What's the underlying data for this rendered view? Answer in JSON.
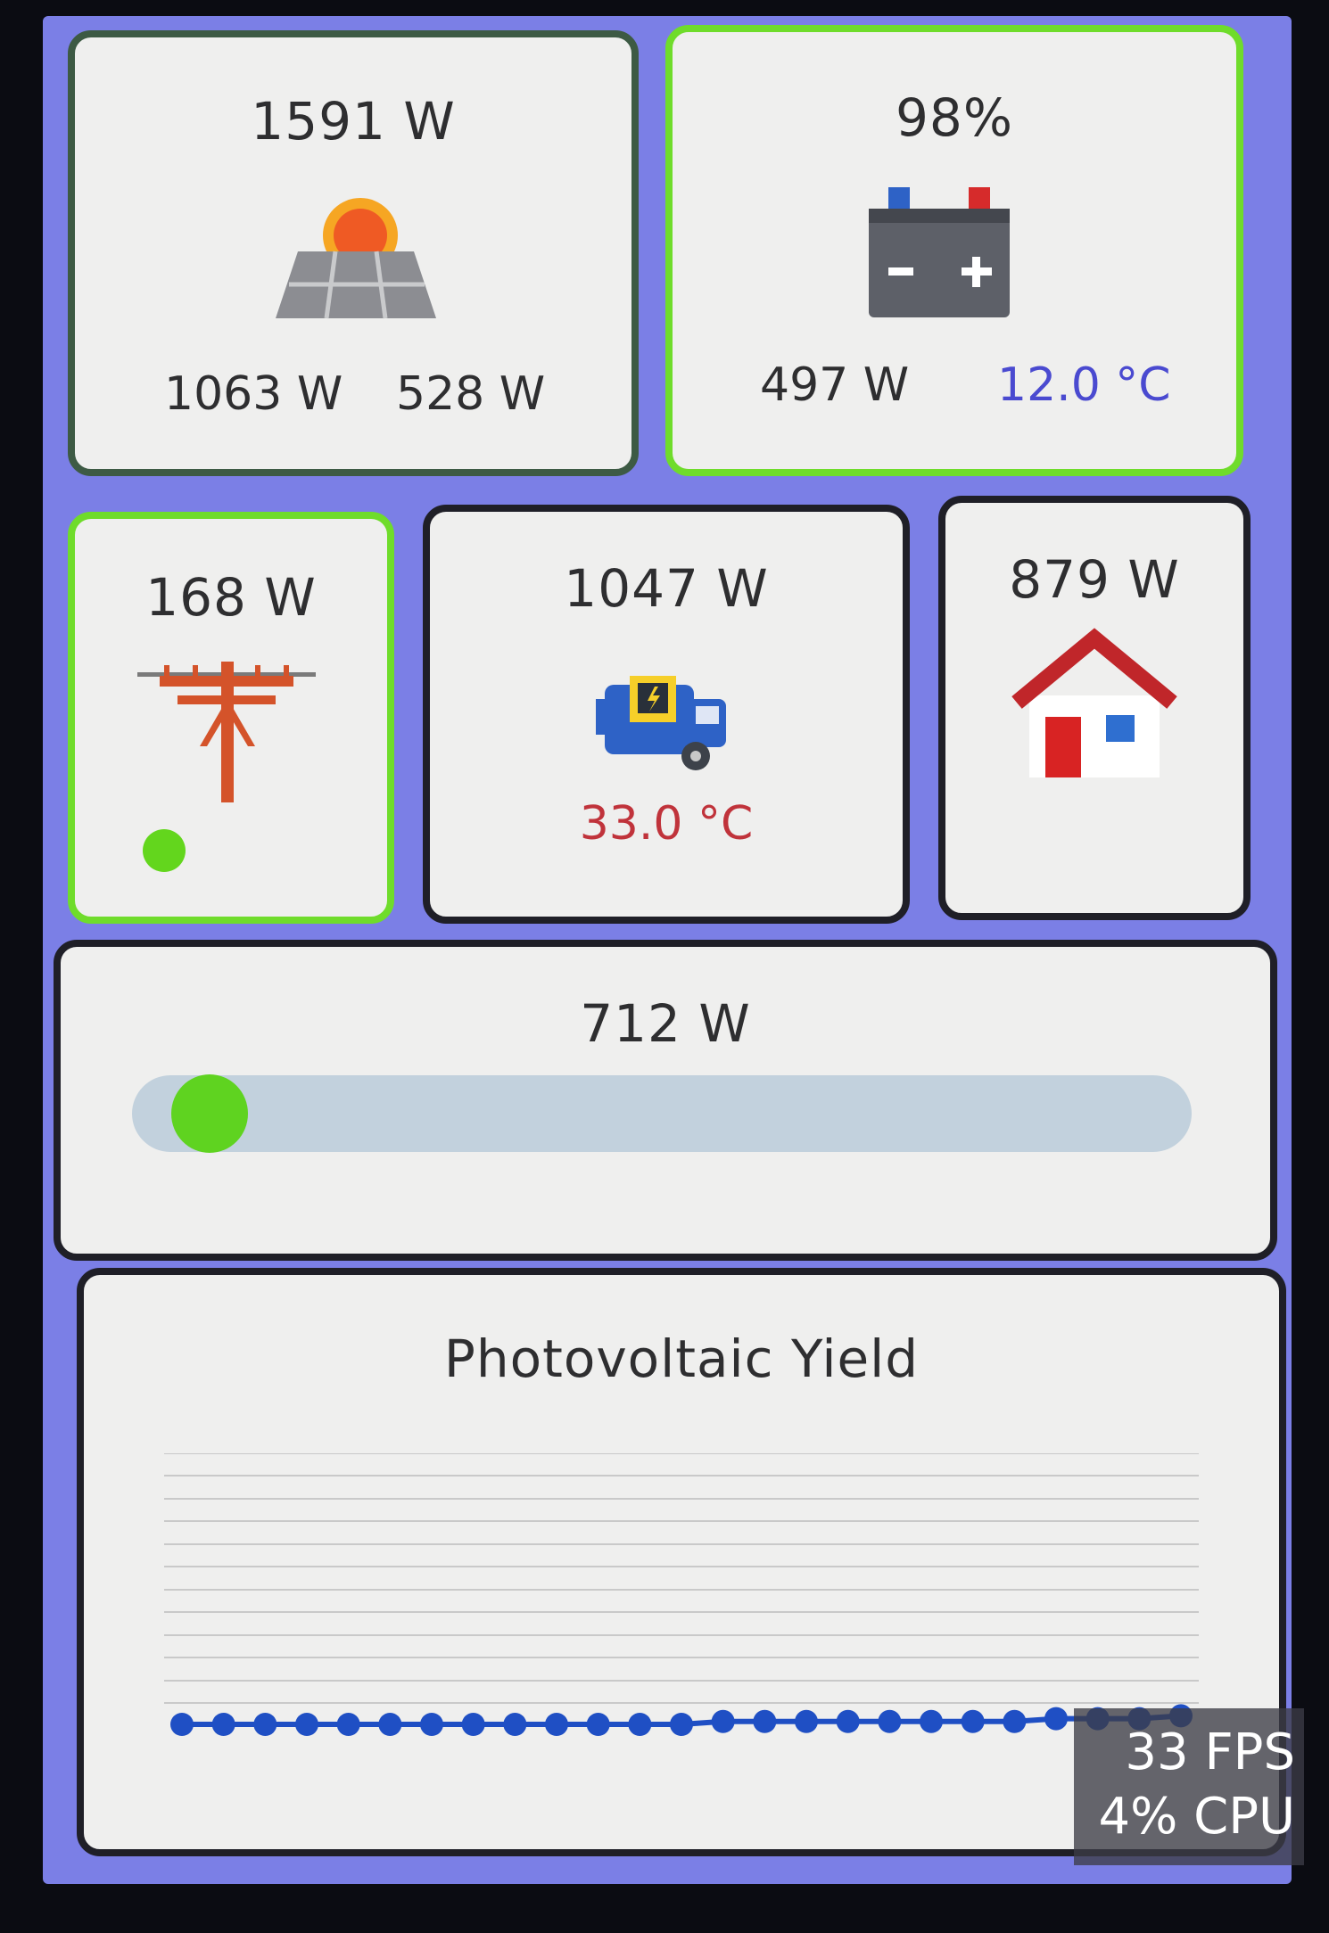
{
  "solar": {
    "total": "1591 W",
    "string1": "1063 W",
    "string2": "528 W",
    "icon": "solar-panel-sun-icon"
  },
  "battery": {
    "soc": "98%",
    "power": "497 W",
    "temperature": "12.0 °C",
    "icon": "battery-icon"
  },
  "grid": {
    "power": "168 W",
    "icon": "power-pole-icon",
    "status_color": "#63d61d"
  },
  "inverter": {
    "power": "1047 W",
    "temperature": "33.0 °C",
    "icon": "inverter-generator-icon"
  },
  "house": {
    "power": "879 W",
    "icon": "house-icon"
  },
  "consumption_bar": {
    "power": "712 W",
    "level": 0.04
  },
  "pv_yield": {
    "title": "Photovoltaic Yield"
  },
  "chart_data": {
    "type": "line",
    "title": "Photovoltaic Yield",
    "gridlines": 12,
    "points": 25,
    "values": [
      0.05,
      0.05,
      0.05,
      0.05,
      0.05,
      0.05,
      0.05,
      0.05,
      0.05,
      0.05,
      0.05,
      0.05,
      0.05,
      0.06,
      0.06,
      0.06,
      0.06,
      0.06,
      0.06,
      0.06,
      0.06,
      0.07,
      0.07,
      0.07,
      0.08
    ],
    "ylim": [
      0,
      1
    ],
    "grid": true
  },
  "overlay": {
    "fps": "33 FPS",
    "cpu": "4% CPU"
  },
  "colors": {
    "background": "#7b7fe6",
    "card": "#efefee",
    "green": "#6fdc2b",
    "temp_battery": "#4a4ad0",
    "temp_inverter": "#c0333b"
  }
}
